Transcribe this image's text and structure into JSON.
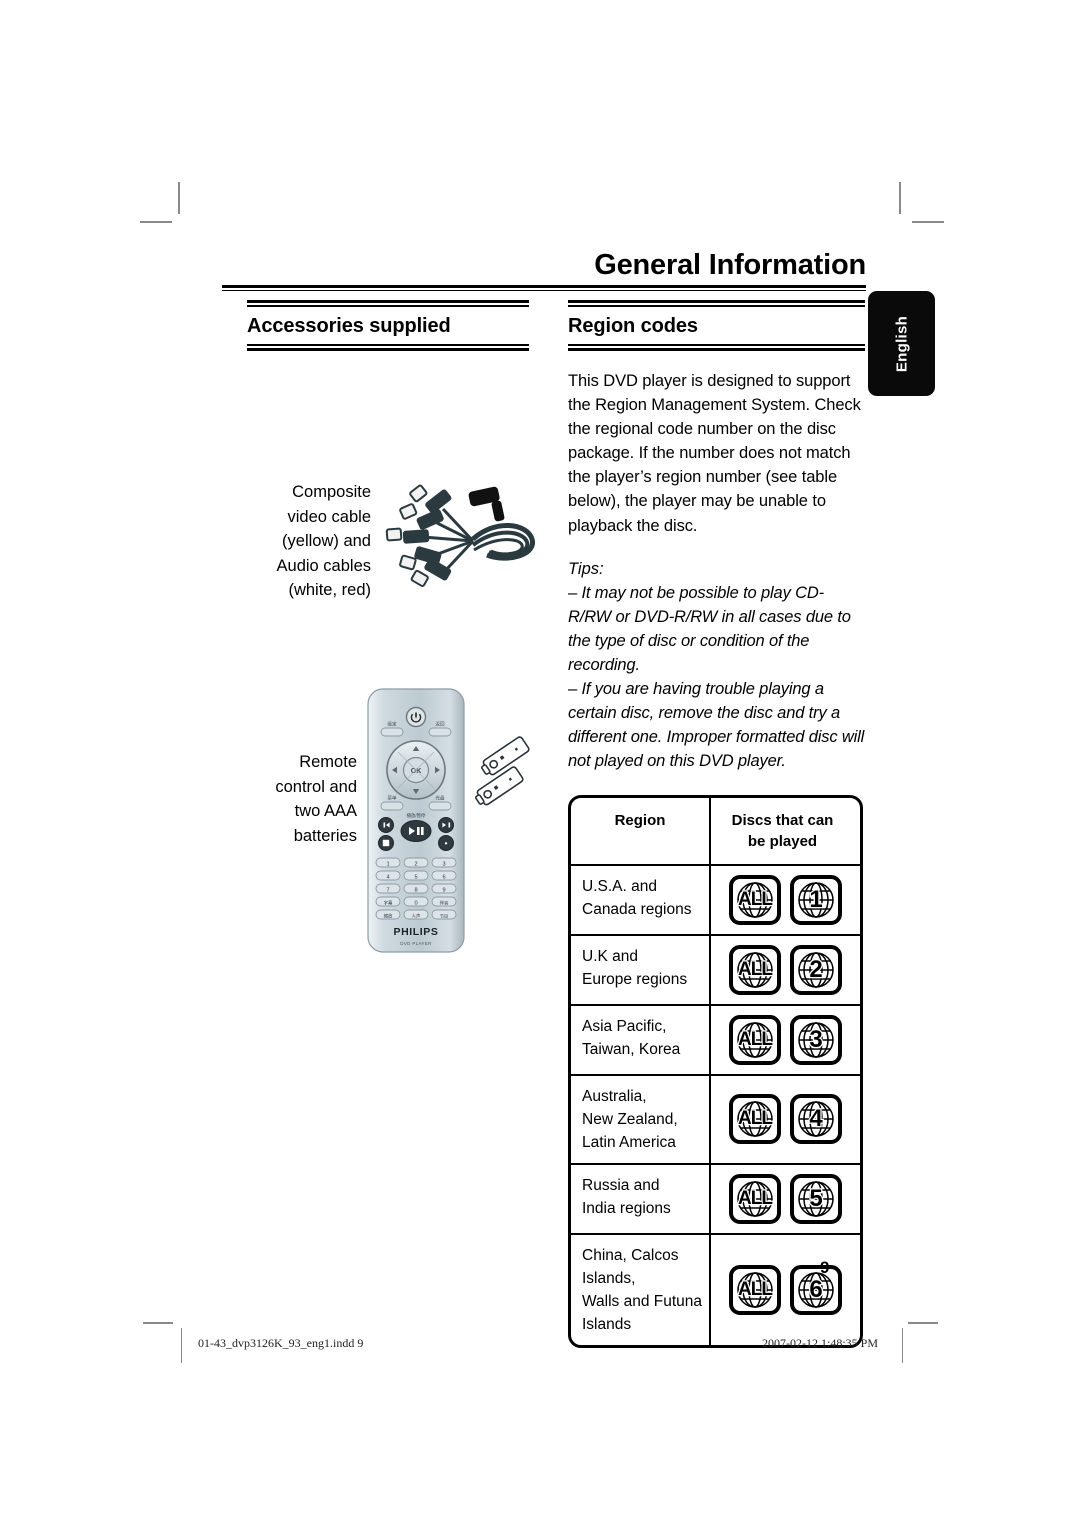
{
  "page": {
    "title": "General Information",
    "number": "9",
    "language_tab": "English"
  },
  "left_column": {
    "heading": "Accessories supplied",
    "figures": [
      {
        "name": "composite-video-and-audio-cables",
        "caption": "Composite\nvideo cable\n(yellow) and\nAudio cables\n(white, red)",
        "caption_lines": [
          "Composite",
          "video cable",
          "(yellow) and",
          "Audio cables",
          "(white, red)"
        ]
      },
      {
        "name": "remote-control-and-batteries",
        "caption_lines": [
          "Remote",
          "control and",
          "two AAA",
          "batteries"
        ],
        "remote": {
          "brand": "PHILIPS",
          "sub_brand": "DVD PLAYER",
          "ok_label": "OK",
          "play_pause_glyph": "▶❙❙",
          "number_keys": [
            "1",
            "2",
            "3",
            "4",
            "5",
            "6",
            "7",
            "8",
            "9",
            "0"
          ]
        }
      }
    ]
  },
  "right_column": {
    "heading": "Region codes",
    "body": "This DVD player is designed to support the Region Management System. Check the regional code number on the disc package. If the number does not match the player’s region number (see table below), the player may be unable to playback the disc.",
    "tips_label": "Tips:",
    "tips": [
      "– It may not be possible to play CD-R/RW or DVD-R/RW in all cases due to the type of disc or condition of the recording.",
      "– If you are having trouble playing a certain disc, remove the disc and try a different one. Improper formatted disc will not played on this DVD player."
    ],
    "table": {
      "headers": {
        "region": "Region",
        "discs": "Discs that can\nbe played",
        "discs_line1": "Discs that can",
        "discs_line2": "be played"
      },
      "rows": [
        {
          "region_lines": [
            "U.S.A. and",
            "Canada regions"
          ],
          "badges": [
            "ALL",
            "1"
          ]
        },
        {
          "region_lines": [
            "U.K and",
            "Europe regions"
          ],
          "badges": [
            "ALL",
            "2"
          ]
        },
        {
          "region_lines": [
            "Asia Pacific,",
            "Taiwan, Korea"
          ],
          "badges": [
            "ALL",
            "3"
          ]
        },
        {
          "region_lines": [
            "Australia,",
            "New Zealand,",
            "Latin America"
          ],
          "badges": [
            "ALL",
            "4"
          ]
        },
        {
          "region_lines": [
            "Russia and",
            "India regions"
          ],
          "badges": [
            "ALL",
            "5"
          ]
        },
        {
          "region_lines": [
            "China, Calcos Islands,",
            "Walls and Futuna",
            "Islands"
          ],
          "badges": [
            "ALL",
            "6"
          ]
        }
      ]
    }
  },
  "footer": {
    "file": "01-43_dvp3126K_93_eng1.indd   9",
    "date": "2007-02-12   1:48:35 PM"
  },
  "colors": {
    "ink": "#000000",
    "tab_bg": "#0a0a0a",
    "tab_text": "#ffffff",
    "crop_mark": "#8a8a8a",
    "remote_body": "#c3ced4",
    "cable_dark": "#2b3a3f"
  }
}
